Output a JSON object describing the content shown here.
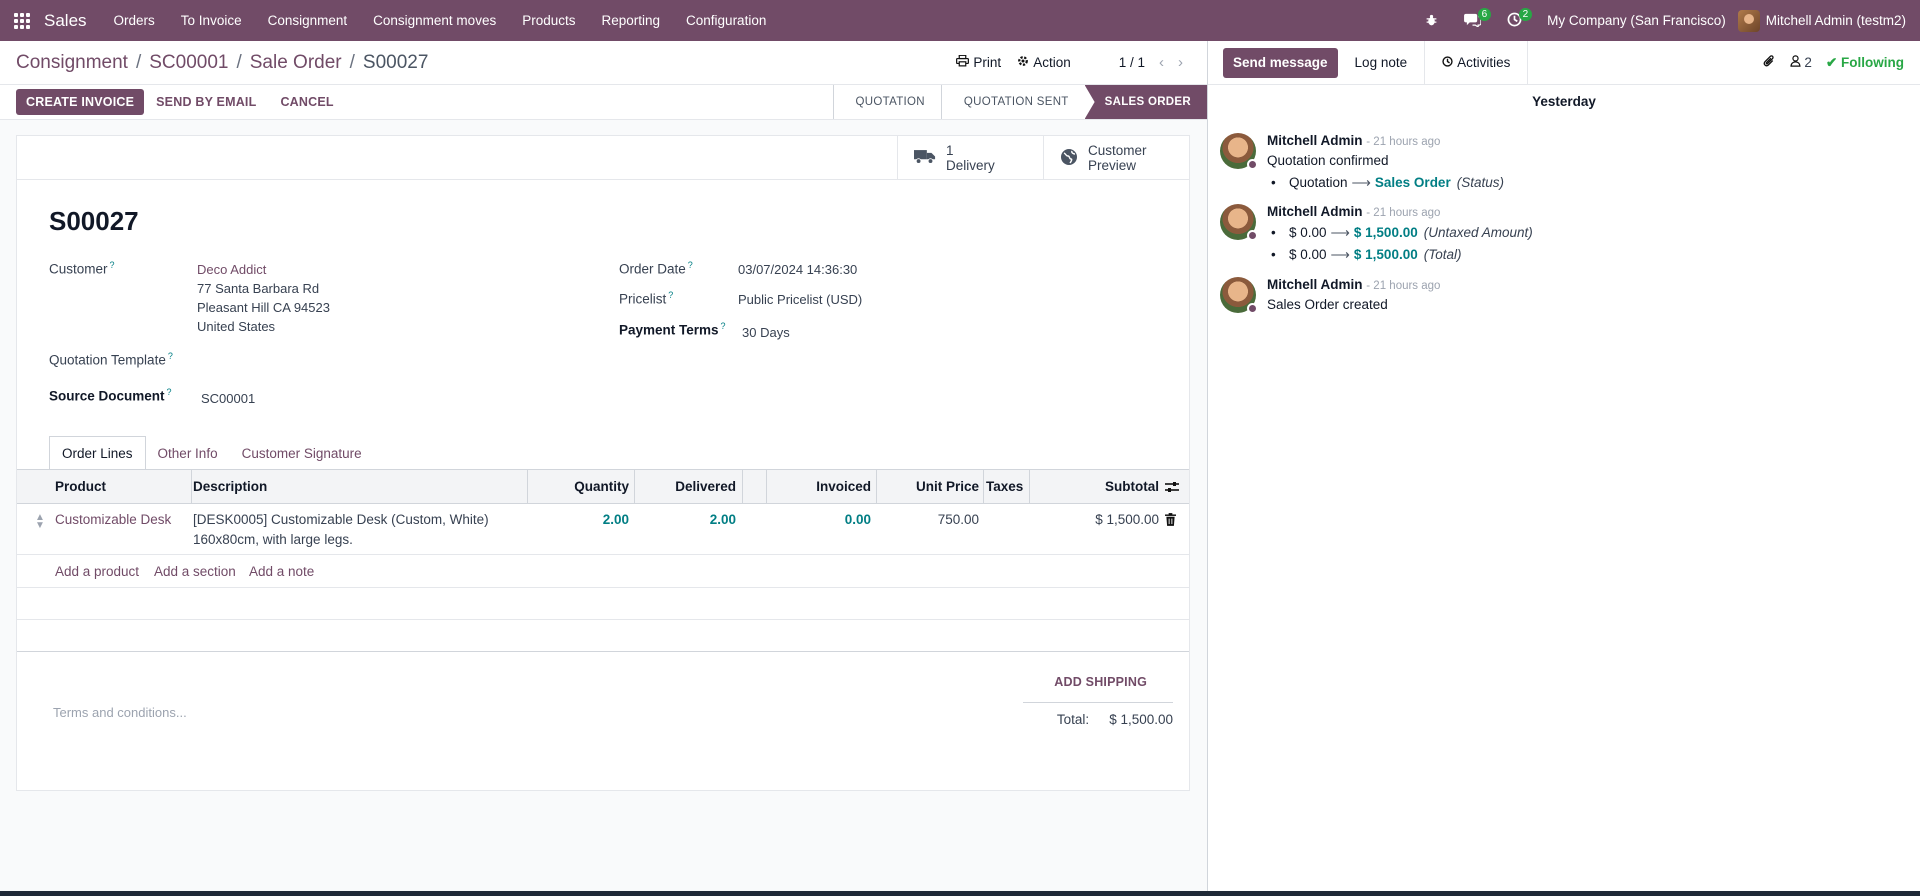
{
  "navbar": {
    "app_name": "Sales",
    "menu": [
      "Orders",
      "To Invoice",
      "Consignment",
      "Consignment moves",
      "Products",
      "Reporting",
      "Configuration"
    ],
    "messages_badge": "6",
    "activities_badge": "2",
    "company": "My Company (San Francisco)",
    "user": "Mitchell Admin (testm2)"
  },
  "breadcrumb": {
    "items": [
      "Consignment",
      "SC00001",
      "Sale Order"
    ],
    "current": "S00027"
  },
  "control_panel": {
    "print": "Print",
    "action": "Action",
    "pager": "1 / 1"
  },
  "statusbar": {
    "create_invoice": "CREATE INVOICE",
    "send_by_email": "SEND BY EMAIL",
    "cancel": "CANCEL",
    "stages": [
      "QUOTATION",
      "QUOTATION SENT",
      "SALES ORDER"
    ],
    "active_stage": "SALES ORDER"
  },
  "smart_buttons": {
    "delivery_count": "1",
    "delivery_label": "Delivery",
    "preview_line1": "Customer",
    "preview_line2": "Preview"
  },
  "form": {
    "title": "S00027",
    "customer_label": "Customer",
    "customer_name": "Deco Addict",
    "customer_address": [
      "77 Santa Barbara Rd",
      "Pleasant Hill CA 94523",
      "United States"
    ],
    "quotation_template_label": "Quotation Template",
    "source_document_label": "Source Document",
    "source_document": "SC00001",
    "order_date_label": "Order Date",
    "order_date": "03/07/2024 14:36:30",
    "pricelist_label": "Pricelist",
    "pricelist": "Public Pricelist (USD)",
    "payment_terms_label": "Payment Terms",
    "payment_terms": "30 Days",
    "help_mark": "?"
  },
  "tabs": [
    "Order Lines",
    "Other Info",
    "Customer Signature"
  ],
  "table": {
    "headers": [
      "Product",
      "Description",
      "Quantity",
      "Delivered",
      "Invoiced",
      "Unit Price",
      "Taxes",
      "Subtotal"
    ],
    "rows": [
      {
        "product": "Customizable Desk",
        "description_line1": "[DESK0005] Customizable Desk (Custom, White)",
        "description_line2": "160x80cm, with large legs.",
        "quantity": "2.00",
        "delivered": "2.00",
        "invoiced": "0.00",
        "unit_price": "750.00",
        "taxes": "",
        "subtotal": "$ 1,500.00"
      }
    ],
    "add_product": "Add a product",
    "add_section": "Add a section",
    "add_note": "Add a note"
  },
  "footer": {
    "add_shipping": "ADD SHIPPING",
    "terms_placeholder": "Terms and conditions...",
    "total_label": "Total:",
    "total_value": "$ 1,500.00"
  },
  "chatter": {
    "send_message": "Send message",
    "log_note": "Log note",
    "activities": "Activities",
    "followers_count": "2",
    "following": "Following",
    "day": "Yesterday",
    "messages": [
      {
        "author": "Mitchell Admin",
        "ago": "- 21 hours ago",
        "body": "Quotation confirmed",
        "tracking": [
          {
            "old": "Quotation",
            "new": "Sales Order",
            "field": "(Status)"
          }
        ]
      },
      {
        "author": "Mitchell Admin",
        "ago": "- 21 hours ago",
        "body": "",
        "tracking": [
          {
            "old": "$ 0.00",
            "new": "$ 1,500.00",
            "field": "(Untaxed Amount)"
          },
          {
            "old": "$ 0.00",
            "new": "$ 1,500.00",
            "field": "(Total)"
          }
        ]
      },
      {
        "author": "Mitchell Admin",
        "ago": "- 21 hours ago",
        "body": "Sales Order created",
        "tracking": []
      }
    ]
  },
  "colors": {
    "brand": "#714b67",
    "link_teal": "#017e84",
    "following_green": "#28a745"
  }
}
